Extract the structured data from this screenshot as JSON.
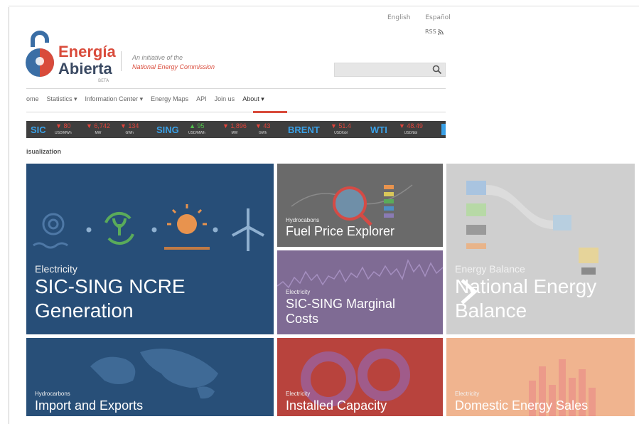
{
  "header": {
    "languages": [
      "English",
      "Español"
    ],
    "rss_label": "RSS",
    "logo": {
      "line1": "Energía",
      "line2": "Abierta",
      "badge": "BETA"
    },
    "initiative_line1": "An initiative of the",
    "initiative_line2": "National Energy Commission",
    "search": {
      "value": "",
      "placeholder": ""
    }
  },
  "nav": {
    "items": [
      "ome",
      "Statistics ▾",
      "Information Center ▾",
      "Energy Maps",
      "API",
      "Join us",
      "About ▾"
    ]
  },
  "ticker": {
    "items": [
      {
        "name": "SIC"
      },
      {
        "value": "▼ 80",
        "unit": "USD/MWh",
        "trend": "down"
      },
      {
        "value": "▼ 6,742",
        "unit": "MW",
        "trend": "down"
      },
      {
        "value": "▼ 134",
        "unit": "GWh",
        "trend": "down"
      },
      {
        "name": "SING"
      },
      {
        "value": "▲ 95",
        "unit": "USD/MWh",
        "trend": "up"
      },
      {
        "value": "▼ 1,896",
        "unit": "MW",
        "trend": "down"
      },
      {
        "value": "▼ 43",
        "unit": "GWh",
        "trend": "down"
      },
      {
        "name": "BRENT"
      },
      {
        "value": "▼ 51.4",
        "unit": "USD/bbl",
        "trend": "down"
      },
      {
        "name": "WTI"
      },
      {
        "value": "▼ 48.49",
        "unit": "USD/bbl",
        "trend": "down"
      }
    ]
  },
  "section_title": "isualization",
  "tiles": {
    "ncre": {
      "category": "Electricity",
      "title_line1": "SIC-SING NCRE",
      "title_line2": "Generation"
    },
    "fuel": {
      "category": "Hydrocabons",
      "title": "Fuel Price Explorer"
    },
    "marginal": {
      "category": "Electricity",
      "title_line1": "SIC-SING Marginal",
      "title_line2": "Costs"
    },
    "balance": {
      "category": "Energy Balance",
      "title_line1": "National Energy",
      "title_line2": "Balance"
    },
    "imports": {
      "category": "Hydrocarbons",
      "title": "Import and Exports"
    },
    "installed": {
      "category": "Electricity",
      "title": "Installed Capacity"
    },
    "domestic": {
      "category": "Electricity",
      "title": "Domestic Energy Sales"
    }
  },
  "colors": {
    "brand_red": "#d94b3b",
    "brand_navy": "#3b4a63",
    "tile_electricity_blue": "#274e78",
    "tile_purple": "#7f6b94",
    "tile_red": "#b8433d",
    "tile_peach": "#f0b48f"
  }
}
